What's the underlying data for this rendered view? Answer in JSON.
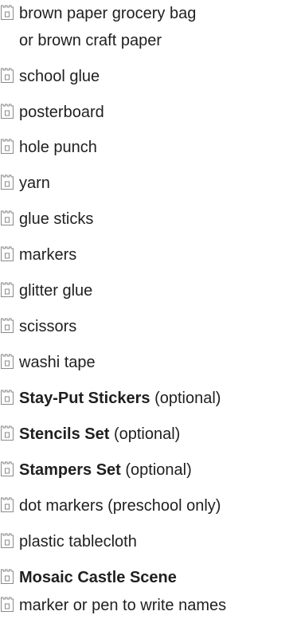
{
  "items": [
    {
      "icon": "castle-icon",
      "bold": "",
      "text": "brown paper grocery bag",
      "text2": "or brown craft paper"
    },
    {
      "icon": "castle-icon",
      "bold": "",
      "text": "school glue"
    },
    {
      "icon": "castle-icon",
      "bold": "",
      "text": "posterboard"
    },
    {
      "icon": "castle-icon",
      "bold": "",
      "text": "hole punch"
    },
    {
      "icon": "castle-icon",
      "bold": "",
      "text": "yarn"
    },
    {
      "icon": "castle-icon",
      "bold": "",
      "text": "glue sticks"
    },
    {
      "icon": "castle-icon",
      "bold": "",
      "text": "markers"
    },
    {
      "icon": "castle-icon",
      "bold": "",
      "text": "glitter glue"
    },
    {
      "icon": "castle-icon",
      "bold": "",
      "text": "scissors"
    },
    {
      "icon": "castle-icon",
      "bold": "",
      "text": "washi tape"
    },
    {
      "icon": "castle-icon",
      "bold": "Stay-Put Stickers",
      "text": " (optional)"
    },
    {
      "icon": "castle-icon",
      "bold": "Stencils Set",
      "text": " (optional)"
    },
    {
      "icon": "castle-icon",
      "bold": "Stampers Set",
      "text": " (optional)"
    },
    {
      "icon": "castle-icon",
      "bold": "",
      "text": "dot markers (preschool only)"
    },
    {
      "icon": "castle-icon",
      "bold": "",
      "text": "plastic tablecloth"
    },
    {
      "icon": "castle-icon",
      "bold": "Mosaic Castle Scene",
      "text": ""
    },
    {
      "icon": "castle-icon",
      "bold": "",
      "text": "marker or pen to write names"
    }
  ],
  "colors": {
    "text": "#1f1f1f",
    "icon_stroke": "#8a8a8a"
  }
}
